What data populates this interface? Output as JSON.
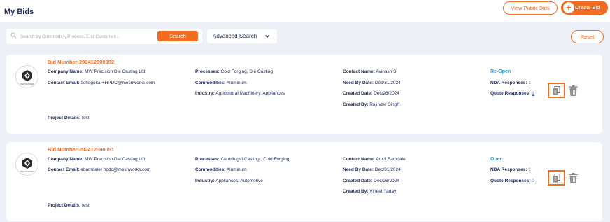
{
  "header": {
    "title": "My Bids",
    "view_public_bids": "View Public Bids",
    "create_bid": "Create Bid",
    "create_plus": "+"
  },
  "toolbar": {
    "search_placeholder": "Search by Commodity, Process, End Customer...",
    "search_button": "Search",
    "advanced_search": "Advanced Search",
    "advanced_chevron": "⌄",
    "reset": "Reset"
  },
  "labels": {
    "company_name": "Company Name:",
    "contact_email": "Contact Email:",
    "processes": "Processes:",
    "commodities": "Commodities:",
    "industry": "Industry:",
    "contact_name": "Contact Name:",
    "need_by_date": "Need By Date:",
    "created_date": "Created Date:",
    "created_by": "Created By:",
    "nda_responses": "NDA Responses:",
    "quote_responses": "Quote Responses:",
    "project_details": "Project Details:"
  },
  "bids": [
    {
      "bid_number": "Bid Number-202412000052",
      "logo_text": "MW MASTER",
      "company_name": "MW Precision Die Casting Ltd",
      "contact_email": "ashegokar+HPDC@meshworks.com",
      "processes": "Cold Forging, Die Casting",
      "commodities": "Aluminum",
      "industry": "Agricultural Machinery, Appliances",
      "contact_name": "Avinash S",
      "need_by_date": "Dec/31/2024",
      "created_date": "Dec/26/2024",
      "created_by": "Rajinder Singh",
      "status": "Re-Open",
      "nda_responses": "1",
      "quote_responses": "1",
      "project_details": "test"
    },
    {
      "bid_number": "Bid Number-202412000051",
      "logo_text": "MW MASTER",
      "company_name": "MW Precision Die Casting Ltd",
      "contact_email": "abamdale+hpdc@meshworks.com",
      "processes": "Centrifugal Casting , Cold Forging",
      "commodities": "Aluminum",
      "industry": "Appliances, Automotive",
      "contact_name": "Amol Bamdale",
      "need_by_date": "Dec/31/2024",
      "created_date": "Dec/26/2024",
      "created_by": "Vineet Yadav",
      "status": "Open",
      "nda_responses": "1",
      "quote_responses": "0",
      "project_details": "test"
    }
  ],
  "icons": {
    "search": "search-icon",
    "document": "document-icon",
    "trash": "trash-icon",
    "plus": "plus-icon"
  },
  "colors": {
    "accent": "#f26b21",
    "status": "#2aa2d8",
    "text": "#1b2a5c",
    "background": "#eef0f7"
  }
}
